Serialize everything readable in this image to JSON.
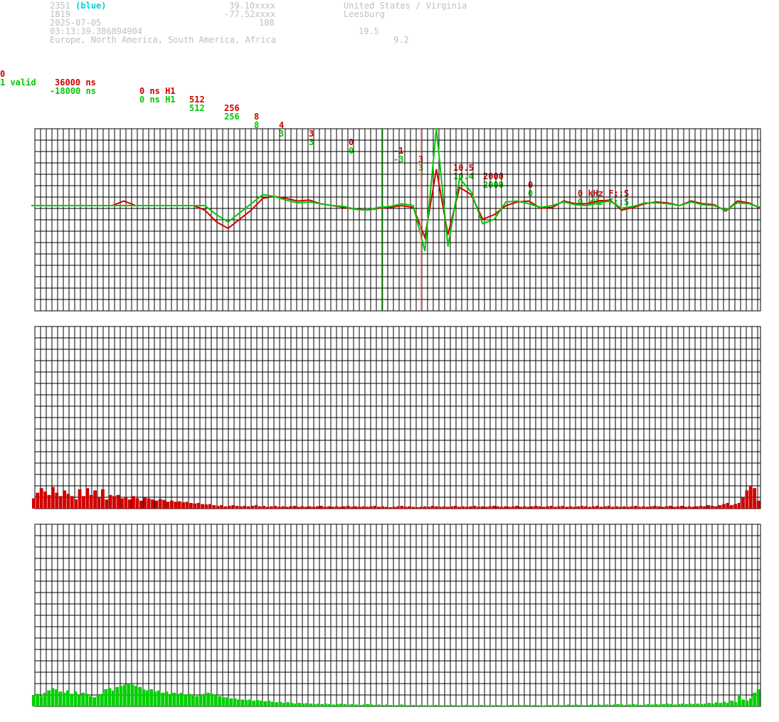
{
  "header": {
    "id": "2351",
    "color_tag": "(blue)",
    "num": "1819",
    "date": "2025-07-05",
    "time": "03:13:39.386894904",
    "regions": "Europe, North America, South America, Africa",
    "lat": "39.10xxxx",
    "lon": "-77.52xxxx",
    "alt": "108",
    "country": "United States / Virginia",
    "city": "Leesburg",
    "v1": "19.5",
    "v2": "9.2"
  },
  "rows": [
    {
      "c0": "0",
      "c1": "36000 ns",
      "c2": "0 ns H1",
      "c3": "512",
      "c4": "256",
      "c5": "8",
      "c6": "4",
      "c7": "3",
      "c8": "0",
      "c9": "-1",
      "c10": "3",
      "c11": "10.5",
      "c12": "2000",
      "c13": "0",
      "c14": "0 kHz F;;S"
    },
    {
      "c0": "1 valid",
      "c1": "-18000 ns",
      "c2": "0 ns H1",
      "c3": "512",
      "c4": "256",
      "c5": "8",
      "c6": "3",
      "c7": "3",
      "c8": "0",
      "c9": "-3",
      "c10": "3",
      "c11": "10.4",
      "c12": "2000",
      "c13": "0",
      "c14": "0 kHz F;;S"
    }
  ],
  "colors": {
    "red": "#d00000",
    "green": "#00d000",
    "grid": "#000000"
  },
  "chart_data": [
    {
      "type": "line",
      "x_count": 64,
      "ylim": [
        -1,
        1
      ],
      "grid": true,
      "series": [
        {
          "color": "#d00000",
          "values": [
            0,
            0,
            0,
            0,
            0,
            0,
            0,
            0,
            0.05,
            0,
            0,
            0,
            0,
            0,
            0,
            -0.05,
            -0.18,
            -0.25,
            -0.15,
            -0.05,
            0.08,
            0.1,
            0.08,
            0.05,
            0.06,
            0.02,
            0,
            -0.02,
            -0.04,
            -0.05,
            -0.03,
            -0.02,
            0,
            -0.02,
            -0.35,
            0.4,
            -0.32,
            0.2,
            0.12,
            -0.15,
            -0.1,
            0,
            0.04,
            0.05,
            -0.03,
            -0.02,
            0.05,
            0.02,
            0.02,
            0.05,
            0.06,
            -0.05,
            -0.02,
            0.02,
            0.04,
            0.03,
            0,
            0.05,
            0.02,
            0.01,
            -0.06,
            0.05,
            0.03,
            -0.03
          ]
        },
        {
          "color": "#00c800",
          "values": [
            0,
            0,
            0,
            0,
            0,
            0,
            0,
            0,
            0,
            0,
            0,
            0,
            0,
            0,
            0,
            0,
            -0.1,
            -0.18,
            -0.08,
            0.02,
            0.12,
            0.1,
            0.06,
            0.03,
            0.04,
            0.02,
            0,
            -0.01,
            -0.04,
            -0.05,
            -0.02,
            -0.01,
            0.02,
            0,
            -0.5,
            0.85,
            -0.45,
            0.3,
            0.15,
            -0.2,
            -0.15,
            0.04,
            0.05,
            0.02,
            -0.02,
            0,
            0.04,
            0.01,
            0,
            0.03,
            0.05,
            -0.03,
            -0.01,
            0.03,
            0.03,
            0.02,
            0,
            0.04,
            0.01,
            0,
            -0.05,
            0.03,
            0.02,
            -0.02
          ]
        }
      ]
    },
    {
      "type": "bar",
      "color": "#d00000",
      "ylim": [
        0,
        1
      ],
      "values": [
        0.45,
        0.7,
        0.9,
        0.75,
        0.6,
        0.95,
        0.7,
        0.55,
        0.8,
        0.65,
        0.55,
        0.4,
        0.85,
        0.55,
        0.9,
        0.6,
        0.8,
        0.5,
        0.85,
        0.4,
        0.6,
        0.55,
        0.6,
        0.45,
        0.5,
        0.4,
        0.55,
        0.45,
        0.35,
        0.5,
        0.45,
        0.4,
        0.35,
        0.42,
        0.38,
        0.3,
        0.35,
        0.3,
        0.32,
        0.28,
        0.3,
        0.25,
        0.22,
        0.25,
        0.2,
        0.18,
        0.2,
        0.15,
        0.12,
        0.15,
        0.1,
        0.12,
        0.15,
        0.12,
        0.1,
        0.12,
        0.1,
        0.12,
        0.15,
        0.1,
        0.12,
        0.08,
        0.1,
        0.12,
        0.08,
        0.1,
        0.08,
        0.1,
        0.12,
        0.08,
        0.1,
        0.08,
        0.1,
        0.08,
        0.1,
        0.12,
        0.08,
        0.1,
        0.08,
        0.1,
        0.08,
        0.1,
        0.12,
        0.08,
        0.1,
        0.08,
        0.1,
        0.08,
        0.1,
        0.12,
        0.08,
        0.1,
        0.08,
        0.06,
        0.08,
        0.1,
        0.12,
        0.08,
        0.1,
        0.08,
        0.06,
        0.08,
        0.1,
        0.08,
        0.12,
        0.1,
        0.08,
        0.1,
        0.08,
        0.1,
        0.12,
        0.08,
        0.1,
        0.08,
        0.1,
        0.12,
        0.08,
        0.1,
        0.08,
        0.1,
        0.12,
        0.1,
        0.08,
        0.1,
        0.08,
        0.1,
        0.12,
        0.08,
        0.1,
        0.08,
        0.1,
        0.12,
        0.1,
        0.08,
        0.1,
        0.12,
        0.08,
        0.1,
        0.12,
        0.08,
        0.1,
        0.08,
        0.1,
        0.12,
        0.1,
        0.08,
        0.1,
        0.12,
        0.08,
        0.1,
        0.12,
        0.08,
        0.1,
        0.08,
        0.1,
        0.08,
        0.1,
        0.12,
        0.08,
        0.1,
        0.08,
        0.1,
        0.12,
        0.1,
        0.08,
        0.1,
        0.12,
        0.08,
        0.1,
        0.12,
        0.08,
        0.1,
        0.08,
        0.1,
        0.12,
        0.1,
        0.15,
        0.12,
        0.1,
        0.15,
        0.2,
        0.25,
        0.15,
        0.2,
        0.25,
        0.5,
        0.8,
        1.0,
        0.9,
        0.35
      ]
    },
    {
      "type": "bar",
      "color": "#00d000",
      "ylim": [
        0,
        1
      ],
      "values": [
        0.5,
        0.55,
        0.45,
        0.6,
        0.7,
        0.8,
        0.75,
        0.65,
        0.6,
        0.7,
        0.55,
        0.65,
        0.5,
        0.6,
        0.55,
        0.45,
        0.4,
        0.5,
        0.55,
        0.75,
        0.8,
        0.7,
        0.85,
        0.9,
        0.95,
        1.0,
        0.95,
        0.9,
        0.85,
        0.75,
        0.7,
        0.75,
        0.65,
        0.7,
        0.6,
        0.65,
        0.55,
        0.6,
        0.55,
        0.6,
        0.5,
        0.55,
        0.5,
        0.45,
        0.5,
        0.55,
        0.6,
        0.55,
        0.5,
        0.45,
        0.4,
        0.4,
        0.35,
        0.35,
        0.3,
        0.3,
        0.28,
        0.3,
        0.25,
        0.28,
        0.25,
        0.22,
        0.25,
        0.2,
        0.18,
        0.2,
        0.15,
        0.18,
        0.15,
        0.12,
        0.15,
        0.12,
        0.14,
        0.12,
        0.1,
        0.12,
        0.1,
        0.12,
        0.1,
        0.08,
        0.1,
        0.12,
        0.1,
        0.08,
        0.1,
        0.08,
        0.06,
        0.08,
        0.1,
        0.08,
        0.06,
        0.08,
        0.06,
        0.08,
        0.06,
        0.05,
        0.06,
        0.08,
        0.06,
        0.05,
        0.06,
        0.05,
        0.06,
        0.05,
        0.04,
        0.05,
        0.06,
        0.05,
        0.04,
        0.05,
        0.06,
        0.05,
        0.04,
        0.05,
        0.06,
        0.05,
        0.04,
        0.05,
        0.06,
        0.05,
        0.04,
        0.05,
        0.06,
        0.05,
        0.04,
        0.05,
        0.06,
        0.05,
        0.06,
        0.05,
        0.06,
        0.05,
        0.06,
        0.05,
        0.04,
        0.05,
        0.06,
        0.05,
        0.06,
        0.05,
        0.06,
        0.08,
        0.06,
        0.08,
        0.06,
        0.05,
        0.06,
        0.08,
        0.06,
        0.08,
        0.06,
        0.08,
        0.06,
        0.08,
        0.1,
        0.08,
        0.06,
        0.08,
        0.1,
        0.08,
        0.06,
        0.08,
        0.1,
        0.08,
        0.1,
        0.08,
        0.1,
        0.12,
        0.1,
        0.08,
        0.1,
        0.12,
        0.1,
        0.12,
        0.1,
        0.12,
        0.1,
        0.12,
        0.15,
        0.12,
        0.18,
        0.15,
        0.2,
        0.15,
        0.25,
        0.18,
        0.5,
        0.3,
        0.25,
        0.35,
        0.6,
        0.75
      ]
    }
  ]
}
